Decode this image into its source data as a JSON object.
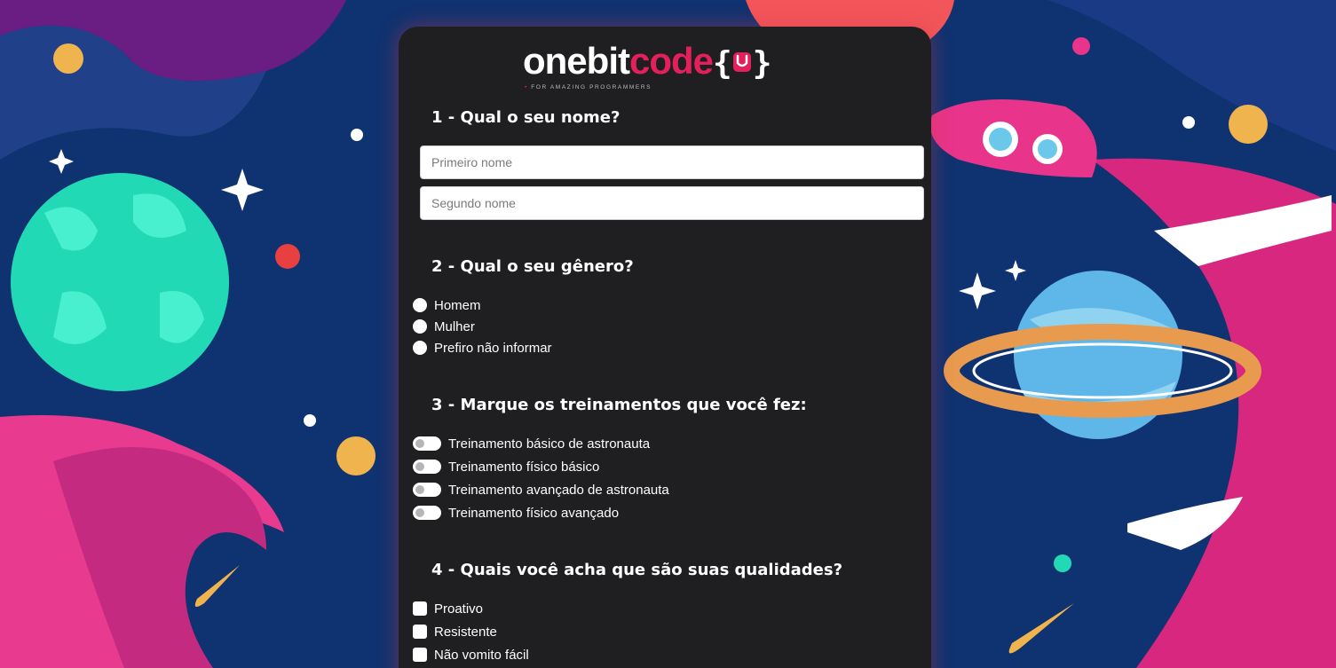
{
  "logo": {
    "brand_white": "onebit",
    "brand_red": "code",
    "brace_open": "{",
    "brace_close": "}",
    "tagline_dot": "•",
    "tagline": "FOR AMAZING PROGRAMMERS"
  },
  "q1": {
    "title": "1 - Qual o seu nome?",
    "first_placeholder": "Primeiro nome",
    "second_placeholder": "Segundo nome"
  },
  "q2": {
    "title": "2 - Qual o seu gênero?",
    "options": [
      "Homem",
      "Mulher",
      "Prefiro não informar"
    ]
  },
  "q3": {
    "title": "3 - Marque os treinamentos que você fez:",
    "options": [
      "Treinamento básico de astronauta",
      "Treinamento físico básico",
      "Treinamento avançado de astronauta",
      "Treinamento físico avançado"
    ]
  },
  "q4": {
    "title": "4 - Quais você acha que são suas qualidades?",
    "options": [
      "Proativo",
      "Resistente",
      "Não vomito fácil"
    ]
  },
  "colors": {
    "card": "#1f1e20",
    "accent": "#e4205c",
    "background": "#0f3270"
  }
}
